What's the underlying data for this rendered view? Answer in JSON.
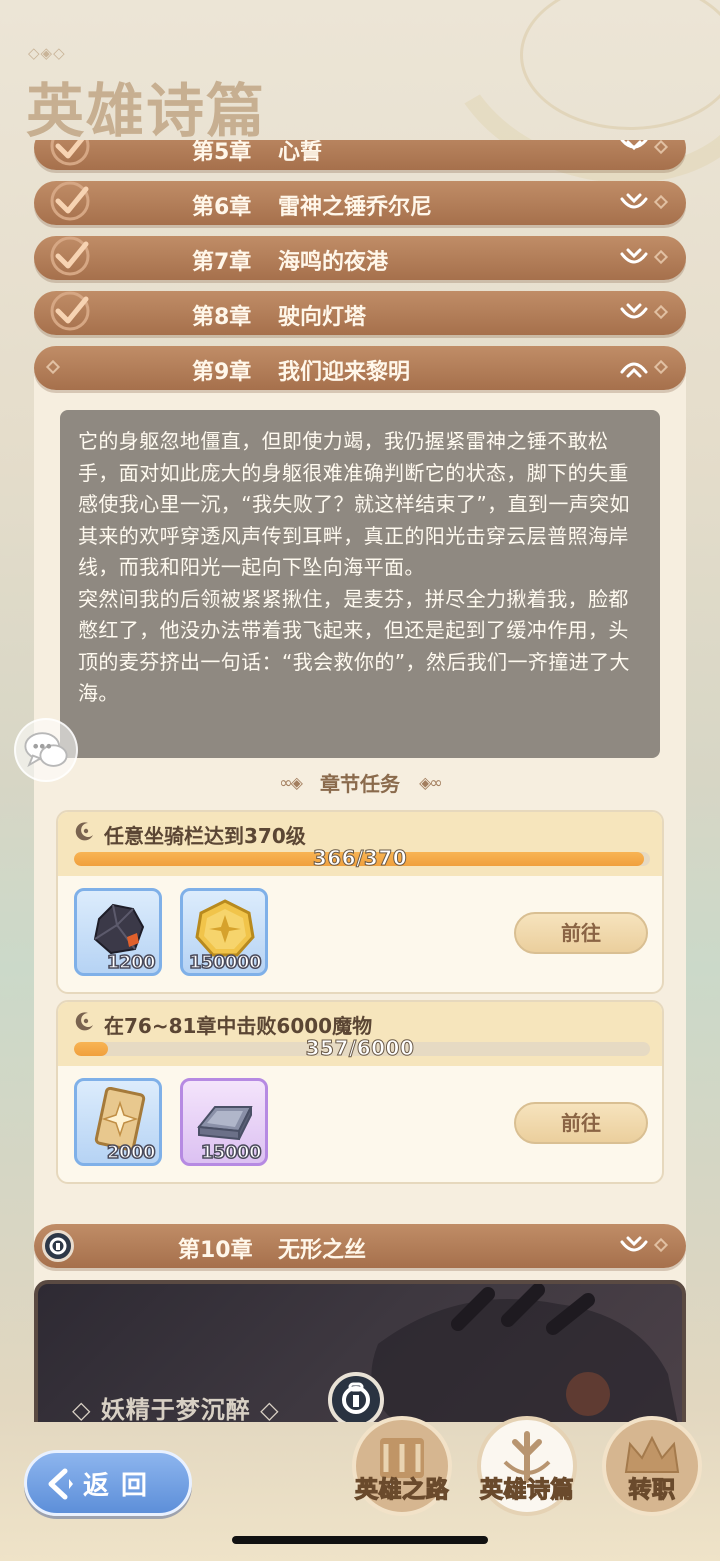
{
  "page": {
    "title": "英雄诗篇",
    "title_dots": "◇◈◇"
  },
  "chapters": [
    {
      "num": "第5章",
      "name": "心誓",
      "completed": true,
      "expanded": false
    },
    {
      "num": "第6章",
      "name": "雷神之锤乔尔尼",
      "completed": true,
      "expanded": false
    },
    {
      "num": "第7章",
      "name": "海鸣的夜港",
      "completed": true,
      "expanded": false
    },
    {
      "num": "第8章",
      "name": "驶向灯塔",
      "completed": true,
      "expanded": false
    },
    {
      "num": "第9章",
      "name": "我们迎来黎明",
      "completed": true,
      "expanded": true
    },
    {
      "num": "第10章",
      "name": "无形之丝",
      "completed": false,
      "locked": true,
      "expanded": false
    }
  ],
  "story": {
    "paragraph1": "它的身躯忽地僵直，但即使力竭，我仍握紧雷神之锤不敢松手，面对如此庞大的身躯很难准确判断它的状态，脚下的失重感使我心里一沉，“我失败了？就这样结束了”，直到一声突如其来的欢呼穿透风声传到耳畔，真正的阳光击穿云层普照海岸线，而我和阳光一起向下坠向海平面。",
    "paragraph2": "突然间我的后领被紧紧揪住，是麦芬，拼尽全力揪着我，脸都憋红了，他没办法带着我飞起来，但还是起到了缓冲作用，头顶的麦芬挤出一句话：“我会救你的”，然后我们一齐撞进了大海。"
  },
  "tasks_header": "章节任务",
  "tasks": [
    {
      "title": "任意坐骑栏达到370级",
      "progress_text": "366/370",
      "progress": 0.989,
      "rewards": [
        {
          "icon": "ore-icon",
          "qty": "1200",
          "frame": "blue"
        },
        {
          "icon": "gold-coin-icon",
          "qty": "150000",
          "frame": "blue"
        }
      ],
      "button": "前往"
    },
    {
      "title": "在76~81章中击败6000魔物",
      "progress_text": "357/6000",
      "progress": 0.0595,
      "rewards": [
        {
          "icon": "star-card-icon",
          "qty": "2000",
          "frame": "blue"
        },
        {
          "icon": "metal-ingot-icon",
          "qty": "15000",
          "frame": "purple"
        }
      ],
      "button": "前往"
    }
  ],
  "chapter10_card": {
    "subtitle": "◇ 妖精于梦沉醉 ◇"
  },
  "bottom_nav": {
    "back": "返回",
    "tabs": [
      {
        "label": "英雄之路"
      },
      {
        "label": "英雄诗篇",
        "active": true
      },
      {
        "label": "转职"
      }
    ]
  },
  "colors": {
    "chapter_bar": "#b07a55",
    "accent_orange": "#f0a03d",
    "back_button": "#6f9ce0",
    "story_bg": "#78736c"
  }
}
